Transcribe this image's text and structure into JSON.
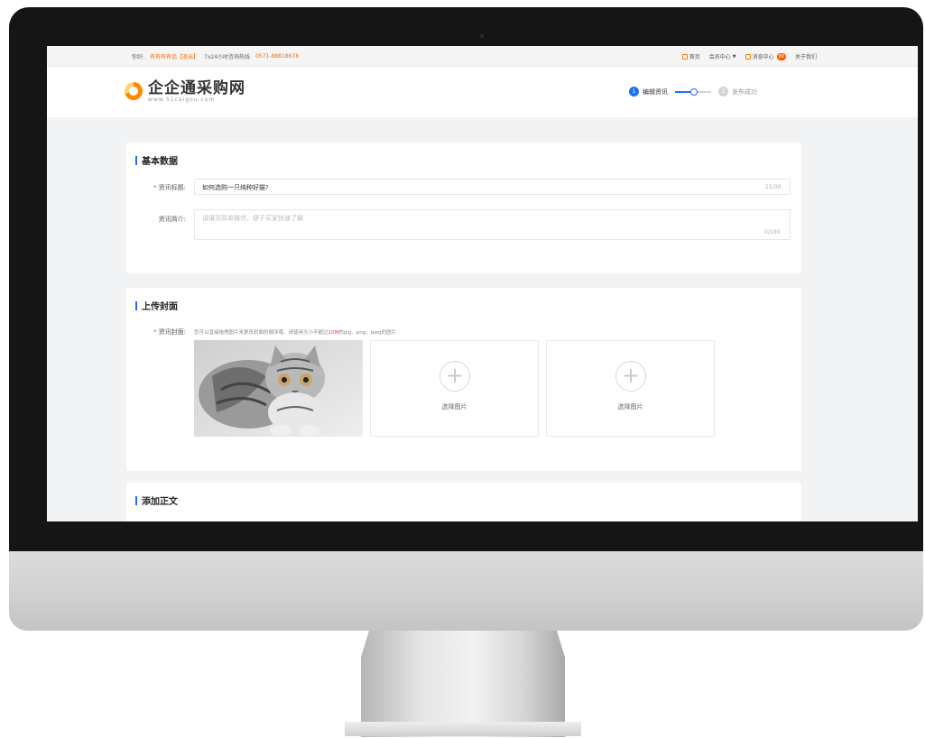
{
  "topbar": {
    "greeting": "你好:",
    "user": "有有有有话【退出】",
    "hotline": "7x24小时咨询热线",
    "phone": "0571-88818678",
    "home": "首页",
    "member_center": "会员中心",
    "message_center": "消息中心",
    "message_badge": "99",
    "about": "关于我们"
  },
  "header": {
    "logo_name": "企企通采购网",
    "logo_url": "www.51caigou.com"
  },
  "steps": [
    {
      "num": "1",
      "label": "编辑资讯"
    },
    {
      "num": "2",
      "label": "发布成功"
    }
  ],
  "basic": {
    "title": "基本数据",
    "title_label": "资讯标题:",
    "title_value": "如何选购一只纯种好猫?",
    "title_counter": "11/30",
    "intro_label": "资讯简介:",
    "intro_placeholder": "请填写简单描述，便于买家快速了解",
    "intro_counter": "0/100"
  },
  "cover": {
    "title": "上传封面",
    "label": "资讯封面:",
    "hint_before": "您可以直接拖拽图片来更改封面的顺序哦，请使用大小不超过",
    "hint_limit": "10M",
    "hint_after": "的jpg、png、jpeg的图片",
    "choose_label": "选择图片"
  },
  "body": {
    "title": "添加正文"
  },
  "colors": {
    "accent": "#1e6fff",
    "brand_orange": "#ff6a00",
    "required": "#ff3b30"
  }
}
